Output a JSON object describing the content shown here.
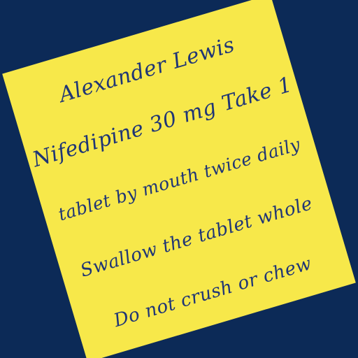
{
  "label": {
    "background_color": "#f7e84a",
    "text_color": "#1f3576",
    "lines": [
      "Alexander Lewis",
      "Nifedipine 30 mg Take 1",
      "tablet by mouth twice daily",
      "Swallow the tablet whole",
      "Do not crush or chew"
    ]
  },
  "page_background_color": "#0c2a57"
}
